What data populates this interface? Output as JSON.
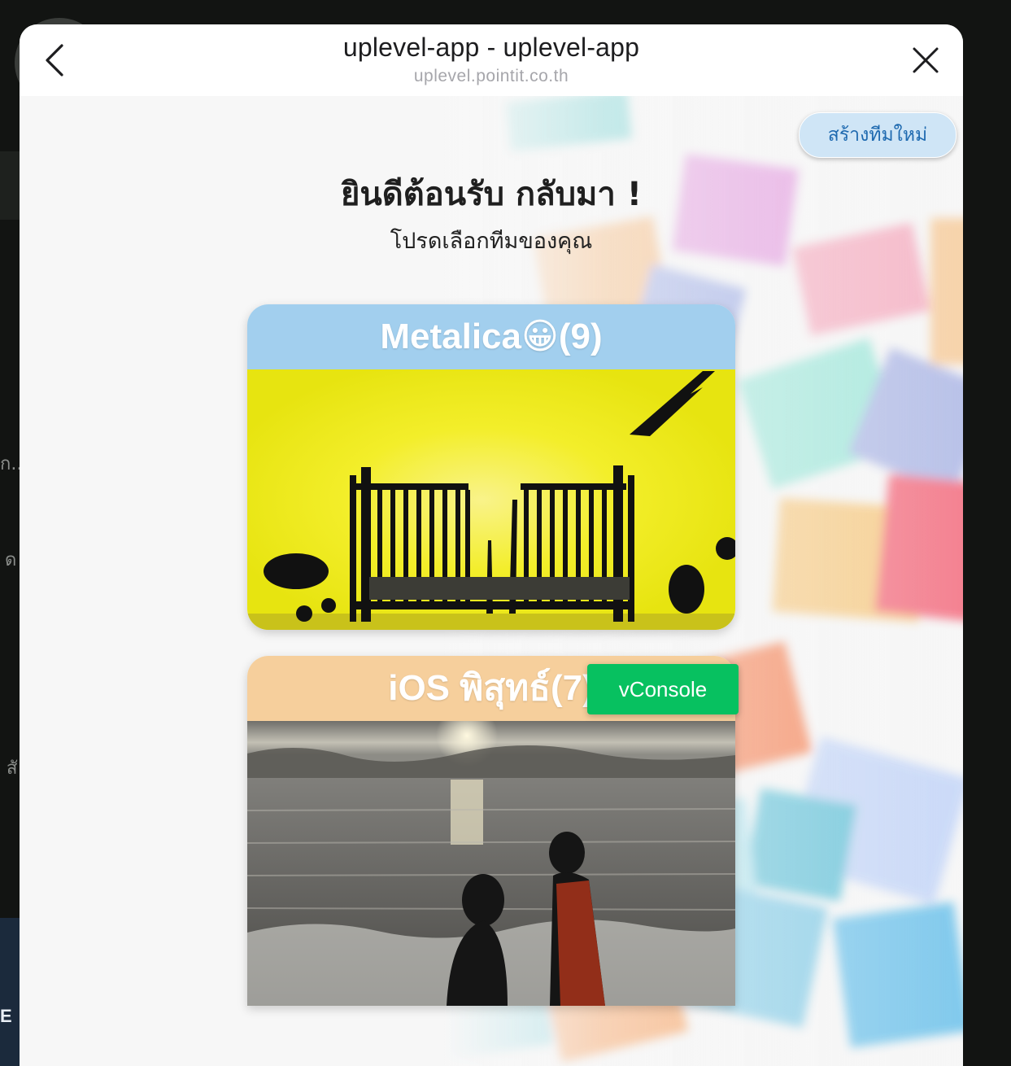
{
  "backdrop": {
    "side_chars": [
      "ก...",
      "ด",
      "สั"
    ],
    "bottom_letter": "E"
  },
  "header": {
    "title": "uplevel-app - uplevel-app",
    "url": "uplevel.pointit.co.th",
    "back_icon": "chevron-left-icon",
    "close_icon": "close-icon"
  },
  "page": {
    "create_team_label": "สร้างทีมใหม่",
    "welcome": "ยินดีต้อนรับ กลับมา !",
    "subtitle": "โปรดเลือกทีมของคุณ"
  },
  "teams": [
    {
      "name": "Metalica😀(9)",
      "header_color": "#a2cfee"
    },
    {
      "name": "iOS พิสุทธ์(7)",
      "header_color": "#f6cf9c"
    }
  ],
  "vconsole": {
    "label": "vConsole",
    "color": "#07c160"
  }
}
